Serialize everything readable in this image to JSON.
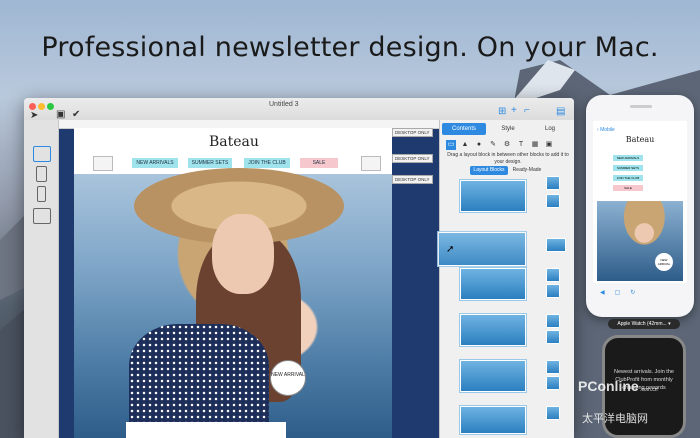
{
  "headline": "Professional newsletter design. On your Mac.",
  "window": {
    "title": "Untitled 3",
    "traffic_colors": [
      "#fc5f57",
      "#fdbc2e",
      "#28c840"
    ]
  },
  "email": {
    "brand": "Bateau",
    "nav": [
      "NEW ARRIVALS",
      "SUMMER SETS",
      "JOIN THE CLUB",
      "SALE"
    ],
    "nav_colors": [
      "#9fe3ec",
      "#9fe3ec",
      "#9fe3ec",
      "#f6c7cd"
    ],
    "badge": "NEW ARRIVAL",
    "desktop_only": "DESKTOP ONLY"
  },
  "panel": {
    "tabs": [
      "Contents",
      "Style",
      "Log"
    ],
    "active_tab": "Contents",
    "hint": "Drag a layout block in between other blocks to add it to your design.",
    "subtabs": [
      "Layout Blocks",
      "Ready-Made"
    ],
    "accent": "#2d8ae0"
  },
  "phone": {
    "back_label": "Mobile",
    "brand": "Bateau",
    "nav": [
      "NEW ARRIVALS",
      "SUMMER SETS",
      "JOIN THE CLUB",
      "SALE"
    ],
    "badge": "NEW ARRIVAL"
  },
  "watch": {
    "selector": "Apple Watch (42mm...",
    "text": "Newest arrivals. Join the ClubProfit from monthly changing rewards"
  },
  "watermark": {
    "brand": "PConline",
    "domain": ".com.cn",
    "sub": "太平洋电脑网"
  }
}
